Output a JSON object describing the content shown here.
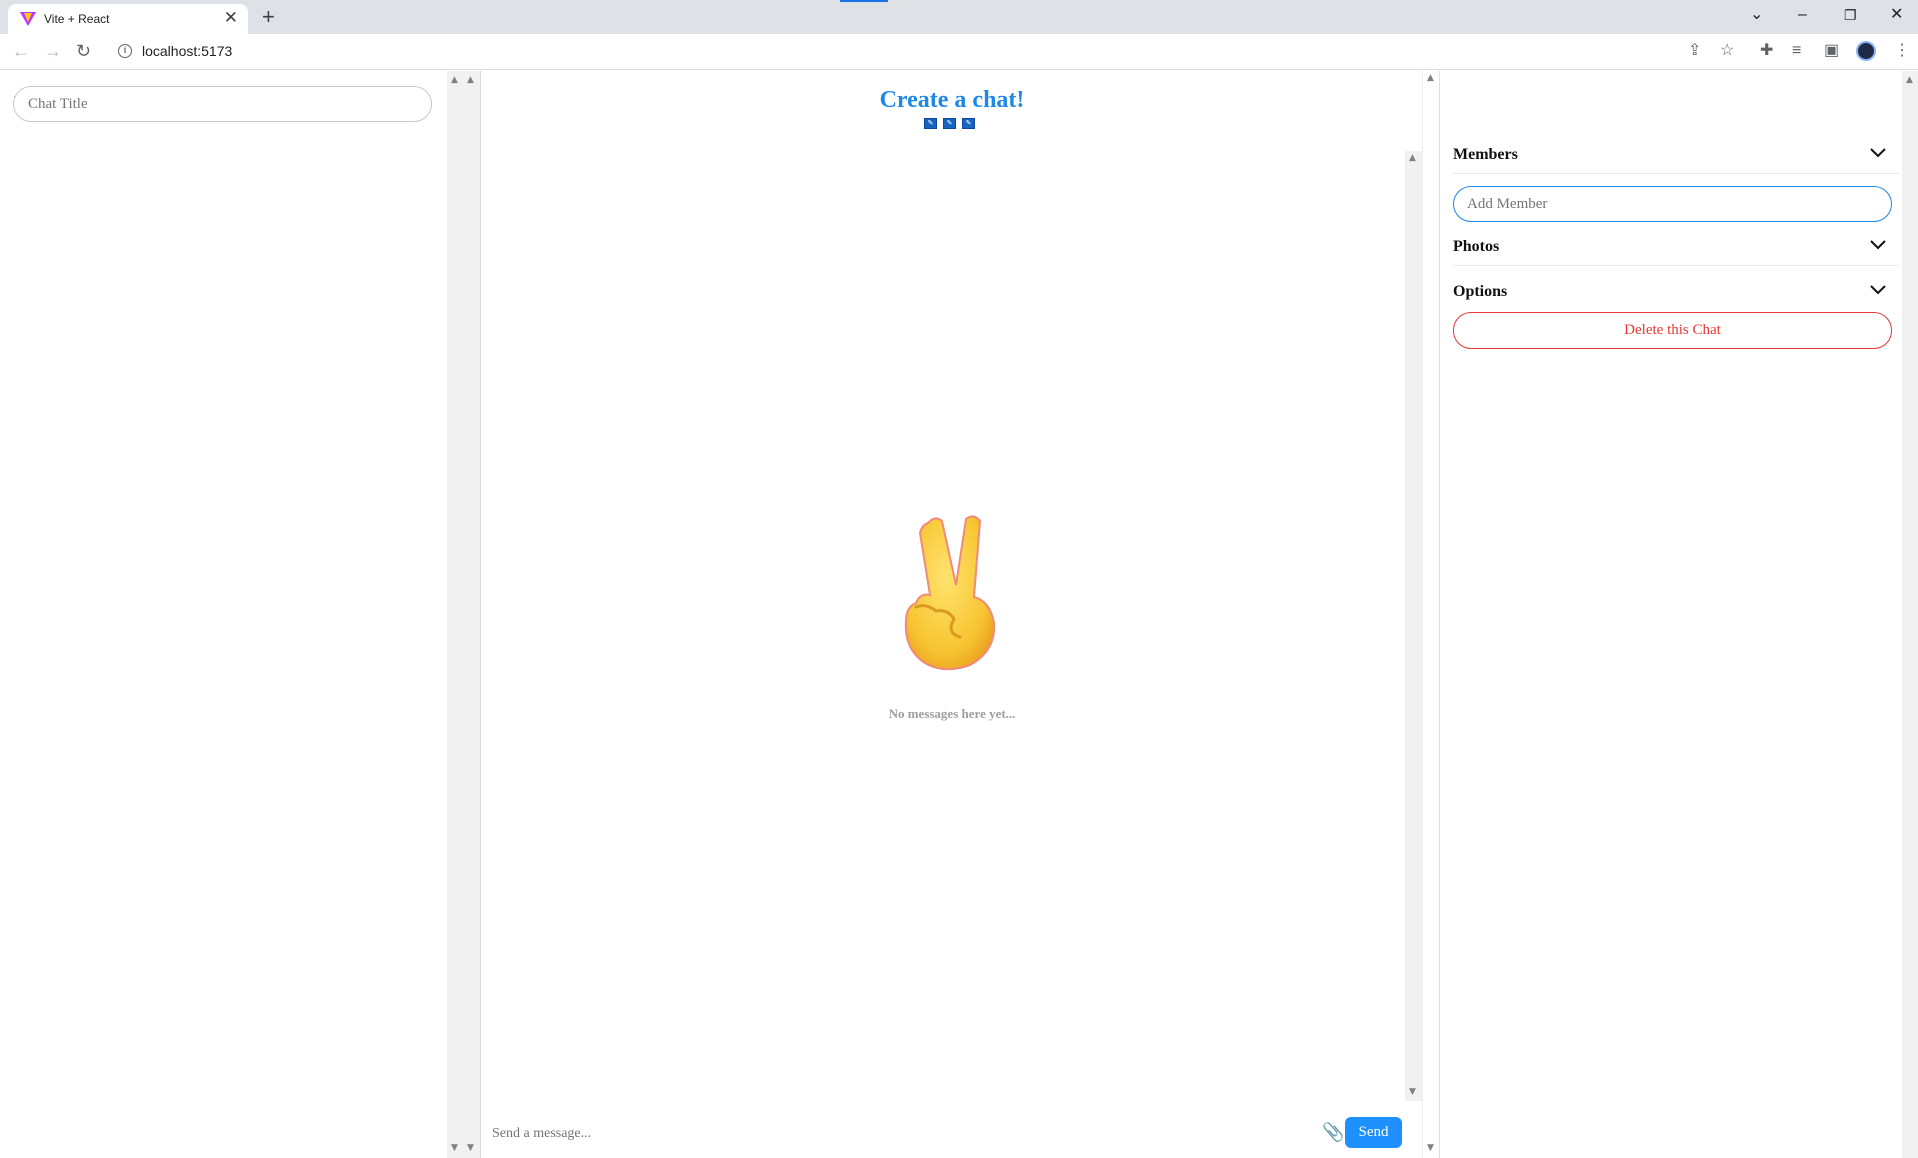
{
  "browser": {
    "tab_title": "Vite + React",
    "tab_close": "✕",
    "new_tab": "+",
    "url": "localhost:5173",
    "controls": {
      "tab_list": "⌄",
      "minimize": "–",
      "restore": "❐",
      "close": "✕"
    }
  },
  "sidebar": {
    "chat_title_placeholder": "Chat Title"
  },
  "chat": {
    "title": "Create a chat!",
    "edit_icons": [
      "✎",
      "✎",
      "✎"
    ],
    "empty_emoji": "✌",
    "empty_text": "No messages here yet...",
    "message_placeholder": "Send a message...",
    "attach_icon": "📎",
    "send_label": "Send"
  },
  "settings": {
    "sections": [
      {
        "label": "Members"
      },
      {
        "label": "Photos"
      },
      {
        "label": "Options"
      }
    ],
    "add_member_placeholder": "Add Member",
    "delete_label": "Delete this Chat"
  },
  "colors": {
    "accent": "#1e88e5",
    "send_button": "#1e90ff",
    "danger": "#e53935",
    "muted_text": "#9e9e9e"
  }
}
